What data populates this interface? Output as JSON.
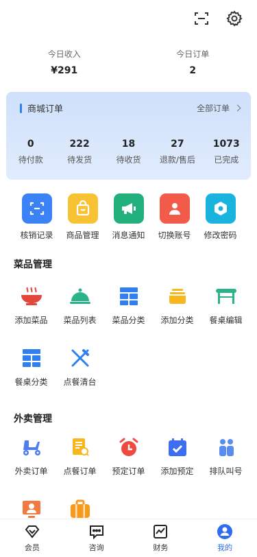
{
  "top_icons": [
    "scan-icon",
    "gear-icon"
  ],
  "stats": [
    {
      "label": "今日收入",
      "value": "¥291"
    },
    {
      "label": "今日订单",
      "value": "2"
    }
  ],
  "order_card": {
    "title": "商城订单",
    "all_link": "全部订单",
    "counts": [
      {
        "value": "0",
        "label": "待付款"
      },
      {
        "value": "222",
        "label": "待发货"
      },
      {
        "value": "18",
        "label": "待收货"
      },
      {
        "value": "27",
        "label": "退款/售后"
      },
      {
        "value": "1073",
        "label": "已完成"
      }
    ]
  },
  "quick": [
    {
      "label": "核销记录",
      "icon": "verify-icon",
      "color": "#3b82f6"
    },
    {
      "label": "商品管理",
      "icon": "bag-icon",
      "color": "#f7c233"
    },
    {
      "label": "消息通知",
      "icon": "megaphone-icon",
      "color": "#22b07d"
    },
    {
      "label": "切换账号",
      "icon": "user-icon",
      "color": "#f25a4a"
    },
    {
      "label": "修改密码",
      "icon": "hexagon-icon",
      "color": "#1ab3e0"
    }
  ],
  "dish_section": {
    "title": "菜品管理",
    "items": [
      {
        "label": "添加菜品",
        "icon": "bowl-icon"
      },
      {
        "label": "菜品列表",
        "icon": "cloche-icon"
      },
      {
        "label": "菜品分类",
        "icon": "grid-icon"
      },
      {
        "label": "添加分类",
        "icon": "stack-icon"
      },
      {
        "label": "餐桌编辑",
        "icon": "table-icon"
      },
      {
        "label": "餐桌分类",
        "icon": "grid-icon"
      },
      {
        "label": "点餐清台",
        "icon": "utensils-icon"
      }
    ]
  },
  "takeout_section": {
    "title": "外卖管理",
    "items": [
      {
        "label": "外卖订单",
        "icon": "scooter-icon"
      },
      {
        "label": "点餐订单",
        "icon": "receipt-icon"
      },
      {
        "label": "预定订单",
        "icon": "alarm-icon"
      },
      {
        "label": "添加预定",
        "icon": "calendar-icon"
      },
      {
        "label": "排队叫号",
        "icon": "people-icon"
      },
      {
        "label": "",
        "icon": "presenter-icon"
      },
      {
        "label": "",
        "icon": "briefcase-icon"
      }
    ]
  },
  "tabbar": [
    {
      "label": "会员",
      "icon": "diamond-icon",
      "active": false
    },
    {
      "label": "咨询",
      "icon": "chat-icon",
      "active": false
    },
    {
      "label": "财务",
      "icon": "chart-icon",
      "active": false
    },
    {
      "label": "我的",
      "icon": "profile-icon",
      "active": true
    }
  ],
  "colors": {
    "accent": "#2f6cf2",
    "card_bg": "#cfe0fb"
  }
}
